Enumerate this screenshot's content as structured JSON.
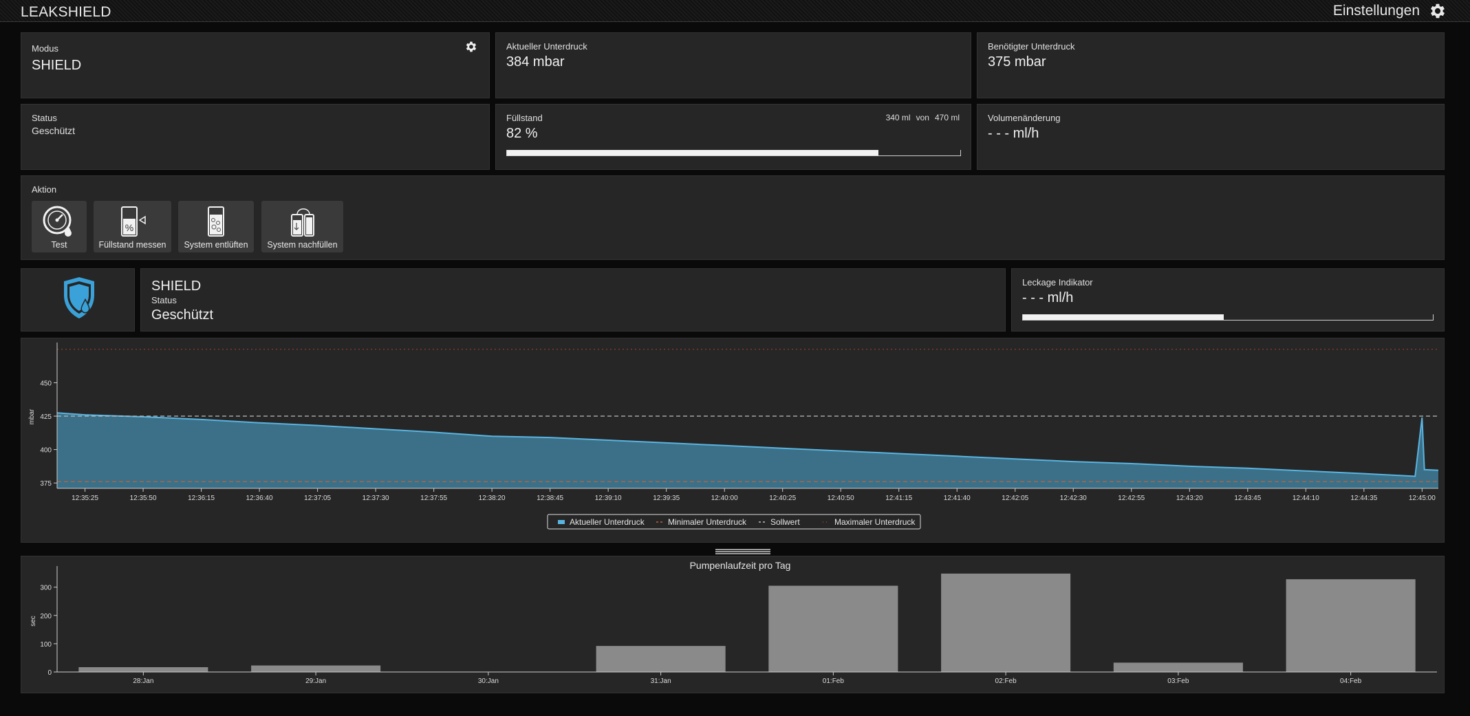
{
  "app": {
    "title": "LEAKSHIELD",
    "settings_label": "Einstellungen"
  },
  "cards": {
    "modus": {
      "label": "Modus",
      "value": "SHIELD"
    },
    "current_vacuum": {
      "label": "Aktueller Unterdruck",
      "value": "384 mbar"
    },
    "required_vacuum": {
      "label": "Benötigter Unterdruck",
      "value": "375 mbar"
    },
    "status": {
      "label": "Status",
      "value": "Geschützt"
    },
    "fill_level": {
      "label": "Füllstand",
      "value": "82 %",
      "current": "340 ml",
      "of": "von",
      "max": "470 ml",
      "fraction": 0.82
    },
    "volume_change": {
      "label": "Volumenänderung",
      "value": "- - - ml/h"
    }
  },
  "actions": {
    "label": "Aktion",
    "buttons": [
      {
        "label": "Test",
        "icon": "gauge-icon"
      },
      {
        "label": "Füllstand messen",
        "icon": "fill-measure-icon"
      },
      {
        "label": "System entlüften",
        "icon": "vent-icon"
      },
      {
        "label": "System nachfüllen",
        "icon": "refill-icon"
      }
    ]
  },
  "shield": {
    "title": "SHIELD",
    "status_label": "Status",
    "status_value": "Geschützt",
    "icon": "shield-drop-icon"
  },
  "leak": {
    "label": "Leckage Indikator",
    "value": "- - - ml/h",
    "fraction": 0.49
  },
  "colors": {
    "accent": "#3aa2d8",
    "area": "#3b7088",
    "line": "#5ab4e0",
    "min_line": "#b8663c",
    "max_line": "#a4472c",
    "setpoint": "#bbbbbb",
    "bar": "#8a8a8a"
  },
  "chart_data": [
    {
      "type": "area",
      "ylabel": "mbar",
      "yticks": [
        375,
        400,
        425,
        450
      ],
      "ylim": [
        371,
        478
      ],
      "xticks": [
        "12:35:25",
        "12:35:50",
        "12:36:15",
        "12:36:40",
        "12:37:05",
        "12:37:30",
        "12:37:55",
        "12:38:20",
        "12:38:45",
        "12:39:10",
        "12:39:35",
        "12:40:00",
        "12:40:25",
        "12:40:50",
        "12:41:15",
        "12:41:40",
        "12:42:05",
        "12:42:30",
        "12:42:55",
        "12:43:20",
        "12:43:45",
        "12:44:10",
        "12:44:35",
        "12:45:00"
      ],
      "x_start": "12:35:13",
      "x_end": "12:45:07",
      "points": [
        [
          "12:35:13",
          427.5
        ],
        [
          "12:35:25",
          426
        ],
        [
          "12:35:50",
          424.5
        ],
        [
          "12:36:15",
          422.5
        ],
        [
          "12:36:40",
          420
        ],
        [
          "12:37:05",
          418
        ],
        [
          "12:37:30",
          415.5
        ],
        [
          "12:37:55",
          413
        ],
        [
          "12:38:20",
          410
        ],
        [
          "12:38:45",
          409
        ],
        [
          "12:39:10",
          407
        ],
        [
          "12:39:35",
          405
        ],
        [
          "12:40:00",
          403
        ],
        [
          "12:40:25",
          401
        ],
        [
          "12:40:50",
          399
        ],
        [
          "12:41:15",
          397
        ],
        [
          "12:41:40",
          395
        ],
        [
          "12:42:05",
          393
        ],
        [
          "12:42:30",
          391
        ],
        [
          "12:42:55",
          389.5
        ],
        [
          "12:43:20",
          387.5
        ],
        [
          "12:43:45",
          386
        ],
        [
          "12:44:10",
          384
        ],
        [
          "12:44:35",
          382
        ],
        [
          "12:44:57",
          380
        ],
        [
          "12:45:00",
          424
        ],
        [
          "12:45:01",
          385
        ],
        [
          "12:45:07",
          384.5
        ]
      ],
      "min_line": 376,
      "setpoint": 425,
      "max_line": 475,
      "legend": [
        "Aktueller Unterdruck",
        "Minimaler Unterdruck",
        "Sollwert",
        "Maximaler Unterdruck"
      ]
    },
    {
      "type": "bar",
      "title": "Pumpenlaufzeit pro Tag",
      "ylabel": "sec",
      "yticks": [
        0,
        100,
        200,
        300
      ],
      "ylim": [
        0,
        360
      ],
      "categories": [
        "28:Jan",
        "29:Jan",
        "30:Jan",
        "31:Jan",
        "01:Feb",
        "02:Feb",
        "03:Feb",
        "04:Feb"
      ],
      "values": [
        17,
        23,
        0,
        92,
        305,
        348,
        33,
        328
      ]
    }
  ]
}
